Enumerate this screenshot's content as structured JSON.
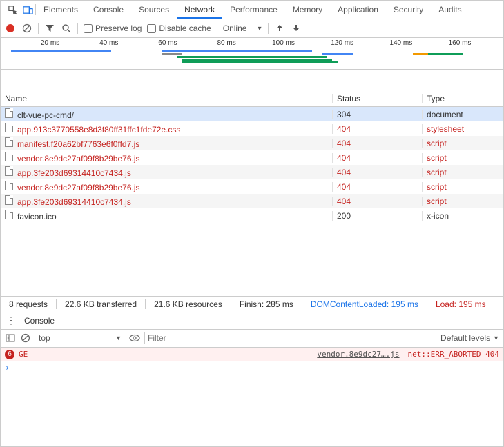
{
  "tabs": [
    "Elements",
    "Console",
    "Sources",
    "Network",
    "Performance",
    "Memory",
    "Application",
    "Security",
    "Audits"
  ],
  "active_tab": "Network",
  "toolbar": {
    "preserve_log": "Preserve log",
    "disable_cache": "Disable cache",
    "throttle_value": "Online"
  },
  "timeline_ticks": [
    "20 ms",
    "40 ms",
    "60 ms",
    "80 ms",
    "100 ms",
    "120 ms",
    "140 ms",
    "160 ms"
  ],
  "columns": {
    "name": "Name",
    "status": "Status",
    "type": "Type"
  },
  "requests": [
    {
      "name": "clt-vue-pc-cmd/",
      "status": "304",
      "type": "document",
      "err": false,
      "selected": true
    },
    {
      "name": "app.913c3770558e8d3f80ff31ffc1fde72e.css",
      "status": "404",
      "type": "stylesheet",
      "err": true
    },
    {
      "name": "manifest.f20a62bf7763e6f0ffd7.js",
      "status": "404",
      "type": "script",
      "err": true
    },
    {
      "name": "vendor.8e9dc27af09f8b29be76.js",
      "status": "404",
      "type": "script",
      "err": true
    },
    {
      "name": "app.3fe203d69314410c7434.js",
      "status": "404",
      "type": "script",
      "err": true
    },
    {
      "name": "vendor.8e9dc27af09f8b29be76.js",
      "status": "404",
      "type": "script",
      "err": true
    },
    {
      "name": "app.3fe203d69314410c7434.js",
      "status": "404",
      "type": "script",
      "err": true
    },
    {
      "name": "favicon.ico",
      "status": "200",
      "type": "x-icon",
      "err": false
    }
  ],
  "summary": {
    "requests": "8 requests",
    "transferred": "22.6 KB transferred",
    "resources": "21.6 KB resources",
    "finish": "Finish: 285 ms",
    "dcl": "DOMContentLoaded: 195 ms",
    "load": "Load: 195 ms"
  },
  "drawer": {
    "tab": "Console",
    "context": "top",
    "filter_placeholder": "Filter",
    "levels": "Default levels",
    "error_badge": "6",
    "error_prefix": "GE",
    "error_link": "vendor.8e9dc27….js",
    "error_tail": "net::ERR_ABORTED 404"
  }
}
